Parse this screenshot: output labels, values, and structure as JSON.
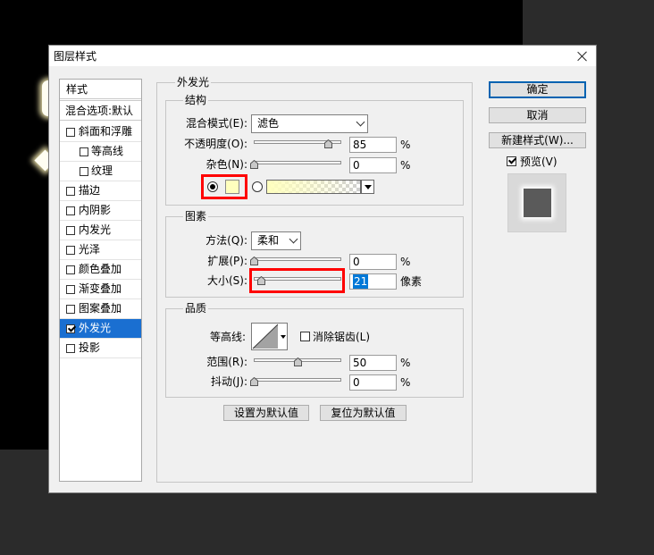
{
  "dialog": {
    "title": "图层样式",
    "close_icon": "close-icon"
  },
  "styles_panel": {
    "header": "样式",
    "blending_options": "混合选项:默认",
    "items": [
      {
        "label": "斜面和浮雕",
        "checked": false,
        "sub_items": [
          {
            "label": "等高线",
            "checked": false
          },
          {
            "label": "纹理",
            "checked": false
          }
        ]
      },
      {
        "label": "描边",
        "checked": false
      },
      {
        "label": "内阴影",
        "checked": false
      },
      {
        "label": "内发光",
        "checked": false
      },
      {
        "label": "光泽",
        "checked": false
      },
      {
        "label": "颜色叠加",
        "checked": false
      },
      {
        "label": "渐变叠加",
        "checked": false
      },
      {
        "label": "图案叠加",
        "checked": false
      },
      {
        "label": "外发光",
        "checked": true,
        "selected": true
      },
      {
        "label": "投影",
        "checked": false
      }
    ]
  },
  "outer_glow": {
    "title": "外发光",
    "structure": {
      "title": "结构",
      "blend_mode": {
        "label": "混合模式(E):",
        "value": "滤色"
      },
      "opacity": {
        "label": "不透明度(O):",
        "value": "85",
        "unit": "%"
      },
      "noise": {
        "label": "杂色(N):",
        "value": "0",
        "unit": "%"
      },
      "source": {
        "color_selected": true,
        "gradient_selected": false,
        "glow_color": "#ffffbe"
      }
    },
    "elements": {
      "title": "图素",
      "technique": {
        "label": "方法(Q):",
        "value": "柔和"
      },
      "spread": {
        "label": "扩展(P):",
        "value": "0",
        "unit": "%"
      },
      "size": {
        "label": "大小(S):",
        "value": "21",
        "unit": "像素",
        "text_selected": true
      }
    },
    "quality": {
      "title": "品质",
      "contour": {
        "label": "等高线:"
      },
      "anti_alias": {
        "label": "消除锯齿(L)",
        "checked": false
      },
      "range": {
        "label": "范围(R):",
        "value": "50",
        "unit": "%"
      },
      "jitter": {
        "label": "抖动(J):",
        "value": "0",
        "unit": "%"
      }
    },
    "make_default_label": "设置为默认值",
    "reset_default_label": "复位为默认值"
  },
  "actions": {
    "ok_label": "确定",
    "cancel_label": "取消",
    "new_style_label": "新建样式(W)...",
    "preview": {
      "label": "预览(V)",
      "checked": true
    }
  },
  "annotations": {
    "highlight_color": "#ff0000"
  },
  "colors": {
    "selection": "#1a6fd1",
    "dialog_bg": "#f0f0f0",
    "canvas_bg": "#000000"
  }
}
